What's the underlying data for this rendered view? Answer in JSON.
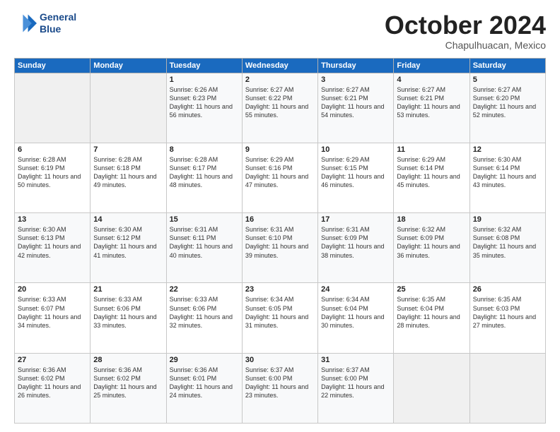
{
  "header": {
    "logo_line1": "General",
    "logo_line2": "Blue",
    "month": "October 2024",
    "location": "Chapulhuacan, Mexico"
  },
  "days_of_week": [
    "Sunday",
    "Monday",
    "Tuesday",
    "Wednesday",
    "Thursday",
    "Friday",
    "Saturday"
  ],
  "weeks": [
    [
      {
        "day": "",
        "empty": true
      },
      {
        "day": "",
        "empty": true
      },
      {
        "day": "1",
        "sunrise": "6:26 AM",
        "sunset": "6:23 PM",
        "daylight": "11 hours and 56 minutes."
      },
      {
        "day": "2",
        "sunrise": "6:27 AM",
        "sunset": "6:22 PM",
        "daylight": "11 hours and 55 minutes."
      },
      {
        "day": "3",
        "sunrise": "6:27 AM",
        "sunset": "6:21 PM",
        "daylight": "11 hours and 54 minutes."
      },
      {
        "day": "4",
        "sunrise": "6:27 AM",
        "sunset": "6:21 PM",
        "daylight": "11 hours and 53 minutes."
      },
      {
        "day": "5",
        "sunrise": "6:27 AM",
        "sunset": "6:20 PM",
        "daylight": "11 hours and 52 minutes."
      }
    ],
    [
      {
        "day": "6",
        "sunrise": "6:28 AM",
        "sunset": "6:19 PM",
        "daylight": "11 hours and 50 minutes."
      },
      {
        "day": "7",
        "sunrise": "6:28 AM",
        "sunset": "6:18 PM",
        "daylight": "11 hours and 49 minutes."
      },
      {
        "day": "8",
        "sunrise": "6:28 AM",
        "sunset": "6:17 PM",
        "daylight": "11 hours and 48 minutes."
      },
      {
        "day": "9",
        "sunrise": "6:29 AM",
        "sunset": "6:16 PM",
        "daylight": "11 hours and 47 minutes."
      },
      {
        "day": "10",
        "sunrise": "6:29 AM",
        "sunset": "6:15 PM",
        "daylight": "11 hours and 46 minutes."
      },
      {
        "day": "11",
        "sunrise": "6:29 AM",
        "sunset": "6:14 PM",
        "daylight": "11 hours and 45 minutes."
      },
      {
        "day": "12",
        "sunrise": "6:30 AM",
        "sunset": "6:14 PM",
        "daylight": "11 hours and 43 minutes."
      }
    ],
    [
      {
        "day": "13",
        "sunrise": "6:30 AM",
        "sunset": "6:13 PM",
        "daylight": "11 hours and 42 minutes."
      },
      {
        "day": "14",
        "sunrise": "6:30 AM",
        "sunset": "6:12 PM",
        "daylight": "11 hours and 41 minutes."
      },
      {
        "day": "15",
        "sunrise": "6:31 AM",
        "sunset": "6:11 PM",
        "daylight": "11 hours and 40 minutes."
      },
      {
        "day": "16",
        "sunrise": "6:31 AM",
        "sunset": "6:10 PM",
        "daylight": "11 hours and 39 minutes."
      },
      {
        "day": "17",
        "sunrise": "6:31 AM",
        "sunset": "6:09 PM",
        "daylight": "11 hours and 38 minutes."
      },
      {
        "day": "18",
        "sunrise": "6:32 AM",
        "sunset": "6:09 PM",
        "daylight": "11 hours and 36 minutes."
      },
      {
        "day": "19",
        "sunrise": "6:32 AM",
        "sunset": "6:08 PM",
        "daylight": "11 hours and 35 minutes."
      }
    ],
    [
      {
        "day": "20",
        "sunrise": "6:33 AM",
        "sunset": "6:07 PM",
        "daylight": "11 hours and 34 minutes."
      },
      {
        "day": "21",
        "sunrise": "6:33 AM",
        "sunset": "6:06 PM",
        "daylight": "11 hours and 33 minutes."
      },
      {
        "day": "22",
        "sunrise": "6:33 AM",
        "sunset": "6:06 PM",
        "daylight": "11 hours and 32 minutes."
      },
      {
        "day": "23",
        "sunrise": "6:34 AM",
        "sunset": "6:05 PM",
        "daylight": "11 hours and 31 minutes."
      },
      {
        "day": "24",
        "sunrise": "6:34 AM",
        "sunset": "6:04 PM",
        "daylight": "11 hours and 30 minutes."
      },
      {
        "day": "25",
        "sunrise": "6:35 AM",
        "sunset": "6:04 PM",
        "daylight": "11 hours and 28 minutes."
      },
      {
        "day": "26",
        "sunrise": "6:35 AM",
        "sunset": "6:03 PM",
        "daylight": "11 hours and 27 minutes."
      }
    ],
    [
      {
        "day": "27",
        "sunrise": "6:36 AM",
        "sunset": "6:02 PM",
        "daylight": "11 hours and 26 minutes."
      },
      {
        "day": "28",
        "sunrise": "6:36 AM",
        "sunset": "6:02 PM",
        "daylight": "11 hours and 25 minutes."
      },
      {
        "day": "29",
        "sunrise": "6:36 AM",
        "sunset": "6:01 PM",
        "daylight": "11 hours and 24 minutes."
      },
      {
        "day": "30",
        "sunrise": "6:37 AM",
        "sunset": "6:00 PM",
        "daylight": "11 hours and 23 minutes."
      },
      {
        "day": "31",
        "sunrise": "6:37 AM",
        "sunset": "6:00 PM",
        "daylight": "11 hours and 22 minutes."
      },
      {
        "day": "",
        "empty": true
      },
      {
        "day": "",
        "empty": true
      }
    ]
  ]
}
